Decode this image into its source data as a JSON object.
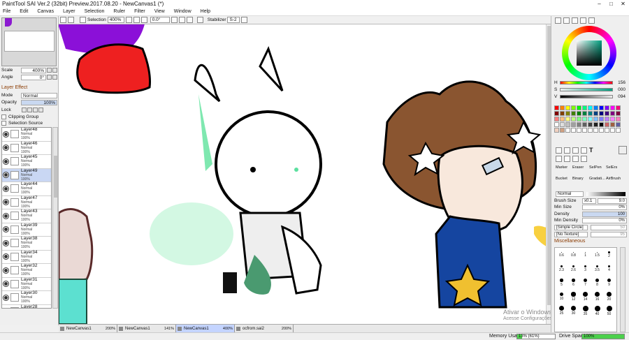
{
  "window": {
    "title": "PaintTool SAI Ver.2 (32bit) Preview.2017.08.20 - NewCanvas1 (*)",
    "minimize": "–",
    "maximize": "□",
    "close": "✕"
  },
  "menu": [
    "File",
    "Edit",
    "Canvas",
    "Layer",
    "Selection",
    "Ruler",
    "Filter",
    "View",
    "Window",
    "Help"
  ],
  "toolbar": {
    "selection_label": "Selection",
    "zoom": "400%",
    "angle": "0.0°",
    "stabilizer_label": "Stabilizer",
    "stabilizer_value": "S-2"
  },
  "navigator": {
    "scale_label": "Scale",
    "scale_value": "400%",
    "angle_label": "Angle",
    "angle_value": "0°"
  },
  "layer_effect": {
    "title": "Layer Effect",
    "mode_label": "Mode",
    "mode_value": "Normal",
    "opacity_label": "Opacity",
    "opacity_value": "100%",
    "lock_label": "Lock",
    "clipping_group": "Clipping Group",
    "selection_source": "Selection Source"
  },
  "layers": [
    {
      "name": "Layer48",
      "mode": "Normal",
      "opacity": "100%"
    },
    {
      "name": "Layer46",
      "mode": "Normal",
      "opacity": "100%"
    },
    {
      "name": "Layer45",
      "mode": "Normal",
      "opacity": "100%"
    },
    {
      "name": "Layer49",
      "mode": "Normal",
      "opacity": "100%"
    },
    {
      "name": "Layer44",
      "mode": "Normal",
      "opacity": "100%"
    },
    {
      "name": "Layer47",
      "mode": "Normal",
      "opacity": "100%"
    },
    {
      "name": "Layer43",
      "mode": "Normal",
      "opacity": "100%"
    },
    {
      "name": "Layer39",
      "mode": "Normal",
      "opacity": "100%"
    },
    {
      "name": "Layer38",
      "mode": "Normal",
      "opacity": "100%"
    },
    {
      "name": "Layer34",
      "mode": "Normal",
      "opacity": "100%"
    },
    {
      "name": "Layer32",
      "mode": "Normal",
      "opacity": "100%"
    },
    {
      "name": "Layer31",
      "mode": "Normal",
      "opacity": "100%"
    },
    {
      "name": "Layer30",
      "mode": "Normal",
      "opacity": "100%"
    },
    {
      "name": "Layer28",
      "mode": "Normal",
      "opacity": "100%"
    }
  ],
  "tabs": [
    {
      "name": "NewCanvas1",
      "zoom": "200%"
    },
    {
      "name": "NewCanvas1",
      "zoom": "141%"
    },
    {
      "name": "NewCanvas1",
      "zoom": "400%"
    },
    {
      "name": "ocfrom.sai2",
      "zoom": "200%"
    }
  ],
  "status": {
    "memory_label": "Memory Usage",
    "memory_value": "13% (61%)",
    "memory_fraction": 0.13,
    "drive_label": "Drive Space",
    "drive_value": "100%"
  },
  "watermark": {
    "line1": "Ativar o Windows",
    "line2": "Acesse Configurações"
  },
  "color": {
    "h_label": "H",
    "h_value": "156",
    "s_label": "S",
    "s_value": "000",
    "v_label": "V",
    "v_value": "094"
  },
  "tools": {
    "names": [
      "Marker",
      "Eraser",
      "SelPen",
      "SelErs",
      "Bucket",
      "Binary",
      "Gradati...",
      "AirBrush"
    ],
    "blend_mode": "Normal"
  },
  "brush": {
    "size_label": "Brush Size",
    "size_mult": "x0.1",
    "size_value": "9.0",
    "min_size_label": "Min Size",
    "min_size_value": "0%",
    "density_label": "Density",
    "density_value": "100",
    "min_density_label": "Min Density",
    "min_density_value": "0%",
    "shape": "[Simple Circle]",
    "shape_value": "50",
    "texture": "[No Texture]",
    "texture_value": "95",
    "misc": "Miscellaneous"
  },
  "brush_sizes": [
    "0.6",
    "0.8",
    "1",
    "1.5",
    "2",
    "2.3",
    "2.6",
    "3",
    "3.5",
    "4",
    "5",
    "6",
    "7",
    "8",
    "9",
    "10",
    "12",
    "14",
    "16",
    "20",
    "25",
    "30",
    "35",
    "40",
    "50"
  ]
}
